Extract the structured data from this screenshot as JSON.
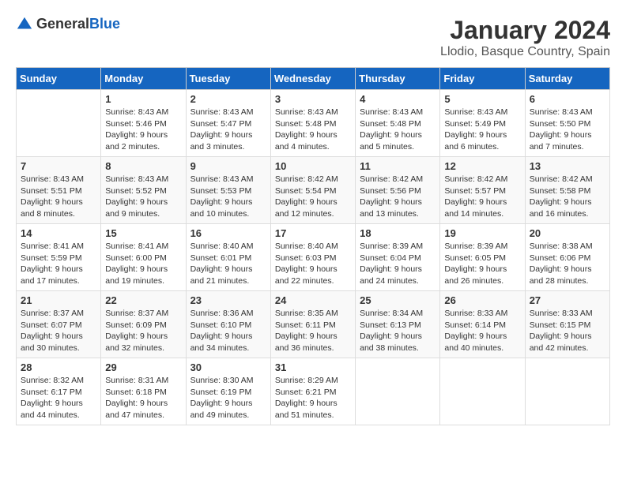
{
  "header": {
    "logo_general": "General",
    "logo_blue": "Blue",
    "month_title": "January 2024",
    "location": "Llodio, Basque Country, Spain"
  },
  "days_of_week": [
    "Sunday",
    "Monday",
    "Tuesday",
    "Wednesday",
    "Thursday",
    "Friday",
    "Saturday"
  ],
  "weeks": [
    [
      {
        "day": "",
        "sunrise": "",
        "sunset": "",
        "daylight": ""
      },
      {
        "day": "1",
        "sunrise": "Sunrise: 8:43 AM",
        "sunset": "Sunset: 5:46 PM",
        "daylight": "Daylight: 9 hours and 2 minutes."
      },
      {
        "day": "2",
        "sunrise": "Sunrise: 8:43 AM",
        "sunset": "Sunset: 5:47 PM",
        "daylight": "Daylight: 9 hours and 3 minutes."
      },
      {
        "day": "3",
        "sunrise": "Sunrise: 8:43 AM",
        "sunset": "Sunset: 5:48 PM",
        "daylight": "Daylight: 9 hours and 4 minutes."
      },
      {
        "day": "4",
        "sunrise": "Sunrise: 8:43 AM",
        "sunset": "Sunset: 5:48 PM",
        "daylight": "Daylight: 9 hours and 5 minutes."
      },
      {
        "day": "5",
        "sunrise": "Sunrise: 8:43 AM",
        "sunset": "Sunset: 5:49 PM",
        "daylight": "Daylight: 9 hours and 6 minutes."
      },
      {
        "day": "6",
        "sunrise": "Sunrise: 8:43 AM",
        "sunset": "Sunset: 5:50 PM",
        "daylight": "Daylight: 9 hours and 7 minutes."
      }
    ],
    [
      {
        "day": "7",
        "sunrise": "Sunrise: 8:43 AM",
        "sunset": "Sunset: 5:51 PM",
        "daylight": "Daylight: 9 hours and 8 minutes."
      },
      {
        "day": "8",
        "sunrise": "Sunrise: 8:43 AM",
        "sunset": "Sunset: 5:52 PM",
        "daylight": "Daylight: 9 hours and 9 minutes."
      },
      {
        "day": "9",
        "sunrise": "Sunrise: 8:43 AM",
        "sunset": "Sunset: 5:53 PM",
        "daylight": "Daylight: 9 hours and 10 minutes."
      },
      {
        "day": "10",
        "sunrise": "Sunrise: 8:42 AM",
        "sunset": "Sunset: 5:54 PM",
        "daylight": "Daylight: 9 hours and 12 minutes."
      },
      {
        "day": "11",
        "sunrise": "Sunrise: 8:42 AM",
        "sunset": "Sunset: 5:56 PM",
        "daylight": "Daylight: 9 hours and 13 minutes."
      },
      {
        "day": "12",
        "sunrise": "Sunrise: 8:42 AM",
        "sunset": "Sunset: 5:57 PM",
        "daylight": "Daylight: 9 hours and 14 minutes."
      },
      {
        "day": "13",
        "sunrise": "Sunrise: 8:42 AM",
        "sunset": "Sunset: 5:58 PM",
        "daylight": "Daylight: 9 hours and 16 minutes."
      }
    ],
    [
      {
        "day": "14",
        "sunrise": "Sunrise: 8:41 AM",
        "sunset": "Sunset: 5:59 PM",
        "daylight": "Daylight: 9 hours and 17 minutes."
      },
      {
        "day": "15",
        "sunrise": "Sunrise: 8:41 AM",
        "sunset": "Sunset: 6:00 PM",
        "daylight": "Daylight: 9 hours and 19 minutes."
      },
      {
        "day": "16",
        "sunrise": "Sunrise: 8:40 AM",
        "sunset": "Sunset: 6:01 PM",
        "daylight": "Daylight: 9 hours and 21 minutes."
      },
      {
        "day": "17",
        "sunrise": "Sunrise: 8:40 AM",
        "sunset": "Sunset: 6:03 PM",
        "daylight": "Daylight: 9 hours and 22 minutes."
      },
      {
        "day": "18",
        "sunrise": "Sunrise: 8:39 AM",
        "sunset": "Sunset: 6:04 PM",
        "daylight": "Daylight: 9 hours and 24 minutes."
      },
      {
        "day": "19",
        "sunrise": "Sunrise: 8:39 AM",
        "sunset": "Sunset: 6:05 PM",
        "daylight": "Daylight: 9 hours and 26 minutes."
      },
      {
        "day": "20",
        "sunrise": "Sunrise: 8:38 AM",
        "sunset": "Sunset: 6:06 PM",
        "daylight": "Daylight: 9 hours and 28 minutes."
      }
    ],
    [
      {
        "day": "21",
        "sunrise": "Sunrise: 8:37 AM",
        "sunset": "Sunset: 6:07 PM",
        "daylight": "Daylight: 9 hours and 30 minutes."
      },
      {
        "day": "22",
        "sunrise": "Sunrise: 8:37 AM",
        "sunset": "Sunset: 6:09 PM",
        "daylight": "Daylight: 9 hours and 32 minutes."
      },
      {
        "day": "23",
        "sunrise": "Sunrise: 8:36 AM",
        "sunset": "Sunset: 6:10 PM",
        "daylight": "Daylight: 9 hours and 34 minutes."
      },
      {
        "day": "24",
        "sunrise": "Sunrise: 8:35 AM",
        "sunset": "Sunset: 6:11 PM",
        "daylight": "Daylight: 9 hours and 36 minutes."
      },
      {
        "day": "25",
        "sunrise": "Sunrise: 8:34 AM",
        "sunset": "Sunset: 6:13 PM",
        "daylight": "Daylight: 9 hours and 38 minutes."
      },
      {
        "day": "26",
        "sunrise": "Sunrise: 8:33 AM",
        "sunset": "Sunset: 6:14 PM",
        "daylight": "Daylight: 9 hours and 40 minutes."
      },
      {
        "day": "27",
        "sunrise": "Sunrise: 8:33 AM",
        "sunset": "Sunset: 6:15 PM",
        "daylight": "Daylight: 9 hours and 42 minutes."
      }
    ],
    [
      {
        "day": "28",
        "sunrise": "Sunrise: 8:32 AM",
        "sunset": "Sunset: 6:17 PM",
        "daylight": "Daylight: 9 hours and 44 minutes."
      },
      {
        "day": "29",
        "sunrise": "Sunrise: 8:31 AM",
        "sunset": "Sunset: 6:18 PM",
        "daylight": "Daylight: 9 hours and 47 minutes."
      },
      {
        "day": "30",
        "sunrise": "Sunrise: 8:30 AM",
        "sunset": "Sunset: 6:19 PM",
        "daylight": "Daylight: 9 hours and 49 minutes."
      },
      {
        "day": "31",
        "sunrise": "Sunrise: 8:29 AM",
        "sunset": "Sunset: 6:21 PM",
        "daylight": "Daylight: 9 hours and 51 minutes."
      },
      {
        "day": "",
        "sunrise": "",
        "sunset": "",
        "daylight": ""
      },
      {
        "day": "",
        "sunrise": "",
        "sunset": "",
        "daylight": ""
      },
      {
        "day": "",
        "sunrise": "",
        "sunset": "",
        "daylight": ""
      }
    ]
  ],
  "accent_color": "#1565c0"
}
